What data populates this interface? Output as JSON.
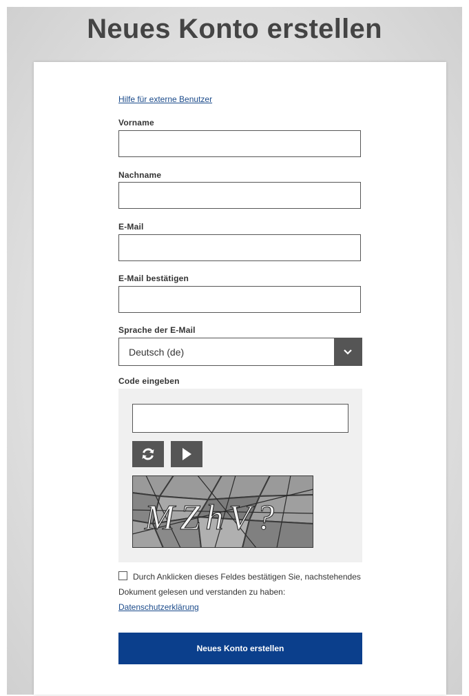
{
  "page_title": "Neues Konto erstellen",
  "help_link": "Hilfe für externe Benutzer",
  "fields": {
    "first_name": {
      "label": "Vorname",
      "value": ""
    },
    "last_name": {
      "label": "Nachname",
      "value": ""
    },
    "email": {
      "label": "E-Mail",
      "value": ""
    },
    "email_confirm": {
      "label": "E-Mail bestätigen",
      "value": ""
    }
  },
  "language": {
    "label": "Sprache der E-Mail",
    "selected": "Deutsch (de)"
  },
  "captcha": {
    "label": "Code eingeben",
    "value": "",
    "image_text": "MZhV?"
  },
  "consent": {
    "text": "Durch Anklicken dieses Feldes bestätigen Sie, nachstehendes Dokument gelesen und verstanden zu haben:",
    "link": "Datenschutzerklärung",
    "checked": false
  },
  "submit_label": "Neues Konto erstellen",
  "colors": {
    "primary_button": "#0b3f8c",
    "link": "#1a4a8a",
    "dark_control": "#555555"
  },
  "icons": {
    "select_arrow": "chevron-down-icon",
    "refresh": "refresh-icon",
    "audio": "play-icon"
  }
}
